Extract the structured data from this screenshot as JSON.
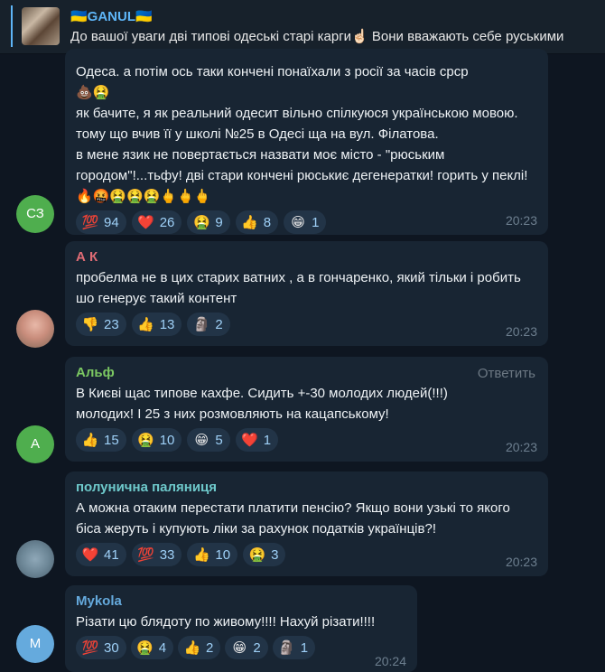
{
  "pinned": {
    "title": "🇺🇦GANUL🇺🇦",
    "text": "До вашої уваги дві типові одеські старі карги☝🏻 Вони вважають себе руськими"
  },
  "messages": [
    {
      "avatar_initials": "СЗ",
      "avatar_color": "#4fae4e",
      "sender": "",
      "text": "Одеса. а потім ось  таки кончені  понаїхали з росії за часів срср\n💩🤮\nяк бачите, я як реальний одесит вільно спілкуюся українською мовою.  тому що вчив її у школі №25 в  Одесі ща на вул. Філатова.\nв мене язик не повертається назвати моє місто - \"рюським городом\"!...тьфу!  дві стари кончені рюськиє  дегенератки! горить у пеклі!🔥🤬🤮🤮🤮🖕🖕🖕",
      "reactions": [
        {
          "emoji": "💯",
          "count": "94"
        },
        {
          "emoji": "❤️",
          "count": "26"
        },
        {
          "emoji": "🤮",
          "count": "9"
        },
        {
          "emoji": "👍",
          "count": "8"
        },
        {
          "emoji": "😁",
          "count": "1"
        }
      ],
      "time": "20:23"
    },
    {
      "avatar_initials": "",
      "avatar_color": "#c9a98c",
      "sender": "А К",
      "sender_color": "#e06c75",
      "text": "пробелма не в цих старих ватних , а в гончаренко, який тільки і робить шо генерує такий контент",
      "reactions": [
        {
          "emoji": "👎",
          "count": "23"
        },
        {
          "emoji": "👍",
          "count": "13"
        },
        {
          "emoji": "🗿",
          "count": "2"
        }
      ],
      "time": "20:23"
    },
    {
      "avatar_initials": "А",
      "avatar_color": "#4fae4e",
      "sender": "Альф",
      "sender_color": "#7bc862",
      "reply_label": "Ответить",
      "text": "В Києві щас типове кахфе. Сидить +-30 молодих людей(!!!)\nмолодих! І 25 з них розмовляють на кацапському!",
      "reactions": [
        {
          "emoji": "👍",
          "count": "15"
        },
        {
          "emoji": "🤮",
          "count": "10"
        },
        {
          "emoji": "😁",
          "count": "5"
        },
        {
          "emoji": "❤️",
          "count": "1"
        }
      ],
      "time": "20:23"
    },
    {
      "avatar_initials": "",
      "avatar_color": "#7d93a4",
      "sender": "полунична паляниця",
      "sender_color": "#6ec9cb",
      "text": "А можна отаким перестати платити пенсію? Якщо вони узькі то якого біса жеруть і купують ліки за рахунок податків українців?!",
      "reactions": [
        {
          "emoji": "❤️",
          "count": "41"
        },
        {
          "emoji": "💯",
          "count": "33"
        },
        {
          "emoji": "👍",
          "count": "10"
        },
        {
          "emoji": "🤮",
          "count": "3"
        }
      ],
      "time": "20:23"
    },
    {
      "avatar_initials": "M",
      "avatar_color": "#65aadd",
      "sender": "Mykola",
      "sender_color": "#65aadd",
      "text": "Різати цю блядоту по живому!!!! Нахуй різати!!!!",
      "reactions": [
        {
          "emoji": "💯",
          "count": "30"
        },
        {
          "emoji": "🤮",
          "count": "4"
        },
        {
          "emoji": "👍",
          "count": "2"
        },
        {
          "emoji": "😁",
          "count": "2"
        },
        {
          "emoji": "🗿",
          "count": "1"
        }
      ],
      "time": "20:24"
    }
  ]
}
